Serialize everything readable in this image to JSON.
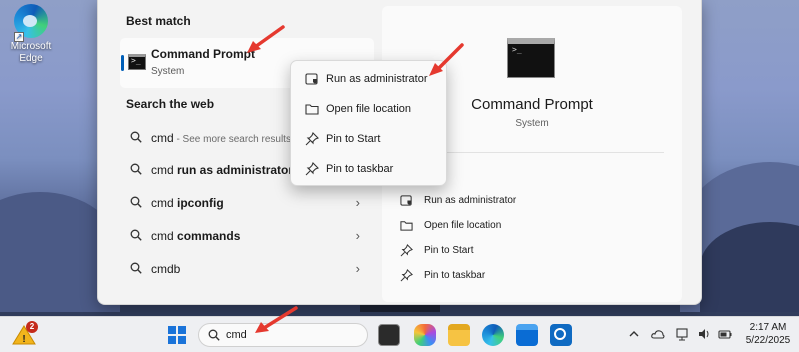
{
  "desktop": {
    "edge_icon": {
      "label": "Microsoft Edge",
      "icon": "edge-icon"
    }
  },
  "search_panel": {
    "best_match_heading": "Best match",
    "best_match": {
      "title": "Command Prompt",
      "subtitle": "System",
      "icon": "command-prompt-icon"
    },
    "search_web_heading": "Search the web",
    "web_results": [
      {
        "query": "cmd",
        "bold": "",
        "hint": " - See more search results"
      },
      {
        "query": "cmd ",
        "bold": "run as administrator",
        "hint": ""
      },
      {
        "query": "cmd ",
        "bold": "ipconfig",
        "hint": ""
      },
      {
        "query": "cmd ",
        "bold": "commands",
        "hint": ""
      },
      {
        "query": "cmdb",
        "bold": "",
        "hint": ""
      }
    ],
    "detail": {
      "title": "Command Prompt",
      "subtitle": "System",
      "actions": [
        {
          "label": "Run as administrator",
          "icon": "shield-window-icon"
        },
        {
          "label": "Open file location",
          "icon": "folder-icon"
        },
        {
          "label": "Pin to Start",
          "icon": "pin-icon"
        },
        {
          "label": "Pin to taskbar",
          "icon": "pin-icon"
        }
      ]
    }
  },
  "context_menu": {
    "items": [
      {
        "label": "Run as administrator",
        "icon": "shield-window-icon"
      },
      {
        "label": "Open file location",
        "icon": "folder-icon"
      },
      {
        "label": "Pin to Start",
        "icon": "pin-icon"
      },
      {
        "label": "Pin to taskbar",
        "icon": "pin-icon"
      }
    ]
  },
  "taskbar": {
    "weather_badge": "2",
    "search_value": "cmd",
    "clock": {
      "time": "2:17 AM",
      "date": "5/22/2025"
    }
  },
  "colors": {
    "accent": "#005fb8",
    "annotation_arrow": "#e5392f",
    "panel_bg": "#f3f3f3",
    "taskbar_bg": "#eeeff2"
  }
}
